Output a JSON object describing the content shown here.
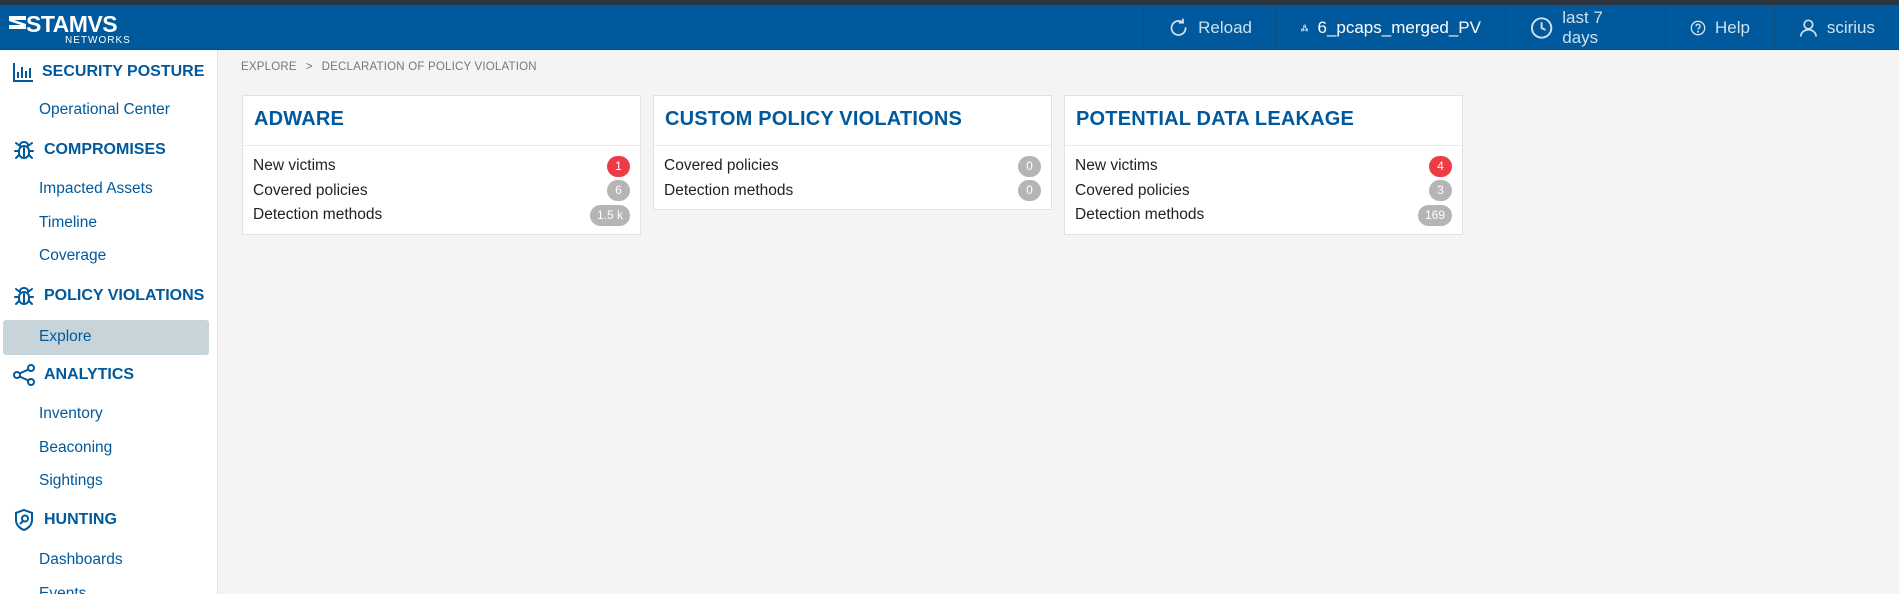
{
  "brand": {
    "name": "STAMVS",
    "sub": "NETWORKS"
  },
  "header": {
    "reload": "Reload",
    "source": "6_pcaps_merged_PV",
    "period": "last 7 days",
    "help": "Help",
    "user": "scirius"
  },
  "sidebar": {
    "sections": [
      {
        "title": "SECURITY POSTURE",
        "icon": "bar-chart-icon",
        "items": [
          "Operational Center"
        ]
      },
      {
        "title": "COMPROMISES",
        "icon": "bug-icon",
        "items": [
          "Impacted Assets",
          "Timeline",
          "Coverage"
        ]
      },
      {
        "title": "POLICY VIOLATIONS",
        "icon": "bug-icon",
        "items": [
          "Explore"
        ]
      },
      {
        "title": "ANALYTICS",
        "icon": "share-nodes-icon",
        "items": [
          "Inventory",
          "Beaconing",
          "Sightings"
        ]
      },
      {
        "title": "HUNTING",
        "icon": "shield-search-icon",
        "items": [
          "Dashboards",
          "Events"
        ]
      }
    ],
    "active_item": "Explore"
  },
  "breadcrumb": {
    "root": "EXPLORE",
    "separator": ">",
    "current": "DECLARATION OF POLICY VIOLATION"
  },
  "cards": [
    {
      "title": "ADWARE",
      "rows": [
        {
          "label": "New victims",
          "value": "1",
          "alert": true
        },
        {
          "label": "Covered policies",
          "value": "6",
          "alert": false
        },
        {
          "label": "Detection methods",
          "value": "1.5 k",
          "alert": false
        }
      ]
    },
    {
      "title": "CUSTOM POLICY VIOLATIONS",
      "rows": [
        {
          "label": "Covered policies",
          "value": "0",
          "alert": false
        },
        {
          "label": "Detection methods",
          "value": "0",
          "alert": false
        }
      ]
    },
    {
      "title": "POTENTIAL DATA LEAKAGE",
      "rows": [
        {
          "label": "New victims",
          "value": "4",
          "alert": true
        },
        {
          "label": "Covered policies",
          "value": "3",
          "alert": false
        },
        {
          "label": "Detection methods",
          "value": "169",
          "alert": false
        }
      ]
    }
  ],
  "colors": {
    "navbar": "#00599c",
    "accent": "#00599c",
    "alert_badge": "#ee3b45",
    "neutral_badge": "#b5b5b5",
    "active_item_bg": "#c7d4da"
  }
}
